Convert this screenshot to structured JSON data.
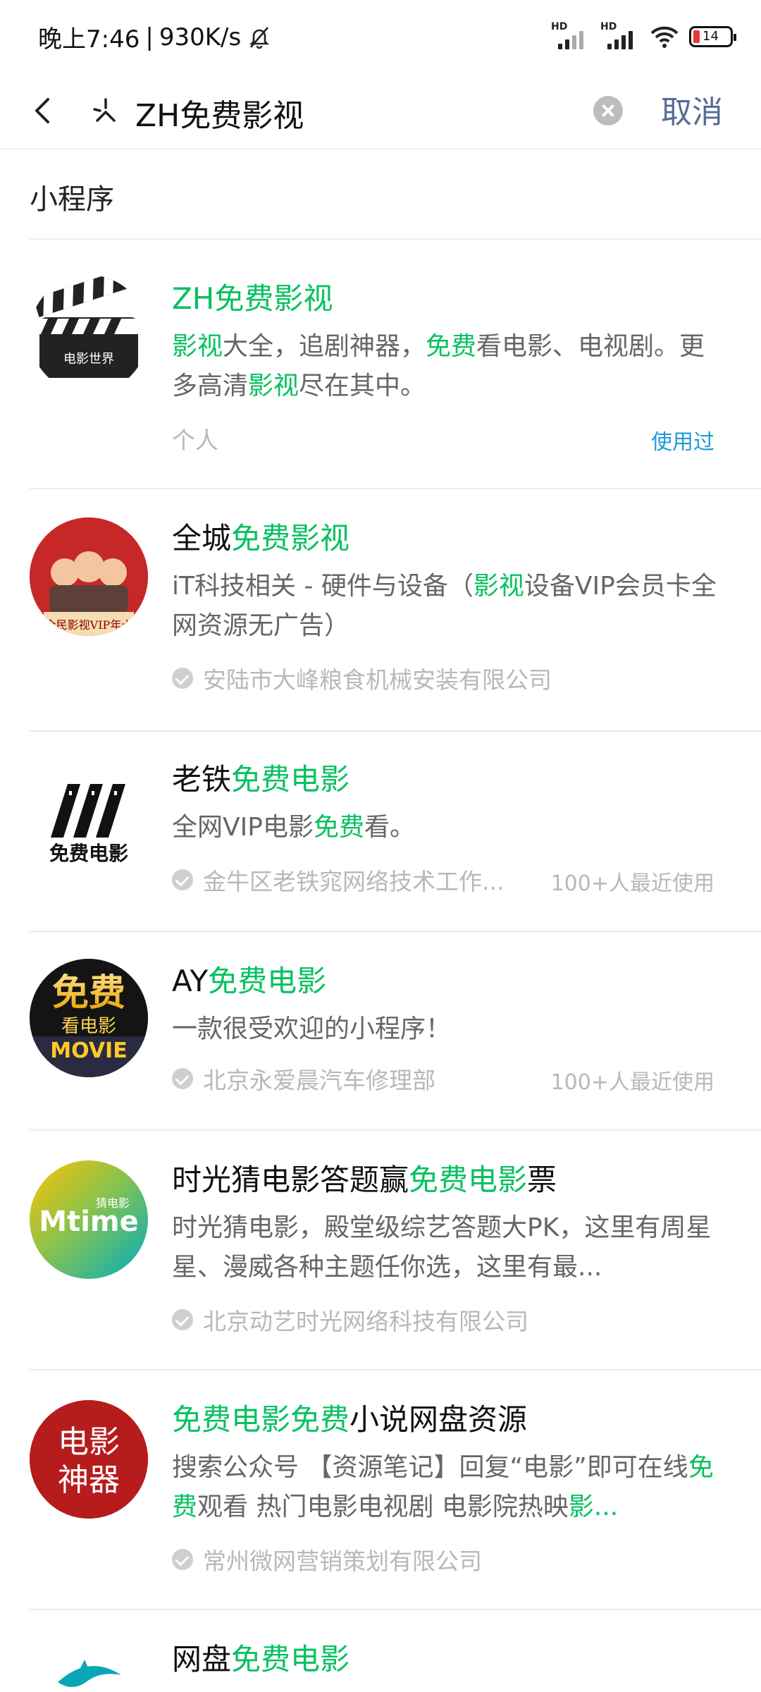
{
  "status": {
    "time": "晚上7:46",
    "separator": "|",
    "speed": "930K/s",
    "signal_label": "HD",
    "battery": "14"
  },
  "search": {
    "query": "ZH免费影视",
    "cancel": "取消"
  },
  "section_title": "小程序",
  "colors": {
    "highlight": "#07c160",
    "link": "#576b95",
    "used": "#1e9bd7"
  },
  "results": [
    {
      "title": [
        [
          "ZH",
          1
        ],
        [
          "免费影视",
          1
        ]
      ],
      "desc": [
        [
          "影视",
          1
        ],
        [
          "大全，追剧神器，",
          0
        ],
        [
          "免费",
          1
        ],
        [
          "看电影、电视剧。更多高清",
          0
        ],
        [
          "影视",
          1
        ],
        [
          "尽在其中。",
          0
        ]
      ],
      "owner": "个人",
      "tag": "使用过",
      "avatar_icon": "clapperboard-icon",
      "avatar_text": "电影世界"
    },
    {
      "title": [
        [
          "全城",
          0
        ],
        [
          "免费影视",
          1
        ]
      ],
      "desc": [
        [
          "iT科技相关 - 硬件与设备（",
          0
        ],
        [
          "影视",
          1
        ],
        [
          "设备VIP会员卡全网资源无广告）",
          0
        ]
      ],
      "owner": "安陆市大峰粮食机械安装有限公司",
      "tag": "",
      "avatar_icon": "poster-icon",
      "avatar_text": "全民影视VIP年卡"
    },
    {
      "title": [
        [
          "老铁",
          0
        ],
        [
          "免费电影",
          1
        ]
      ],
      "desc": [
        [
          "全网VIP电影",
          0
        ],
        [
          "免费",
          1
        ],
        [
          "看。",
          0
        ]
      ],
      "owner": "金牛区老铁窕网络技术工作...",
      "tag": "100+人最近使用",
      "avatar_icon": "film-logo-icon",
      "avatar_text": "免费电影"
    },
    {
      "title": [
        [
          "AY",
          0
        ],
        [
          "免费电影",
          1
        ]
      ],
      "desc": [
        [
          "一款很受欢迎的小程序！",
          0
        ]
      ],
      "owner": "北京永爱晨汽车修理部",
      "tag": "100+人最近使用",
      "avatar_icon": "movie-badge-icon",
      "avatar_text": "免费 看电影 MOVIE"
    },
    {
      "title": [
        [
          "时光猜电影答题赢",
          0
        ],
        [
          "免费电影",
          1
        ],
        [
          "票",
          0
        ]
      ],
      "desc": [
        [
          "时光猜电影，殿堂级综艺答题大PK，这里有周星星、漫威各种主题任你选，这里有最...",
          0
        ]
      ],
      "owner": "北京动艺时光网络科技有限公司",
      "tag": "",
      "avatar_icon": "mtime-icon",
      "avatar_text": "Mtime 猜电影"
    },
    {
      "title": [
        [
          "免费电影免费",
          1
        ],
        [
          "小说网盘资源",
          0
        ]
      ],
      "desc": [
        [
          "搜索公众号 【资源笔记】回复“电影”即可在线",
          0
        ],
        [
          "免费",
          1
        ],
        [
          "观看 热门电影电视剧 电影院热映",
          0
        ],
        [
          "影...",
          1
        ]
      ],
      "owner": "常州微网营销策划有限公司",
      "tag": "",
      "avatar_icon": "movie-tool-icon",
      "avatar_text": "电影 神器"
    },
    {
      "title": [
        [
          "网盘",
          0
        ],
        [
          "免费电影",
          1
        ]
      ],
      "desc": [],
      "owner": "",
      "tag": "",
      "avatar_icon": "dolphin-icon",
      "avatar_text": ""
    }
  ]
}
